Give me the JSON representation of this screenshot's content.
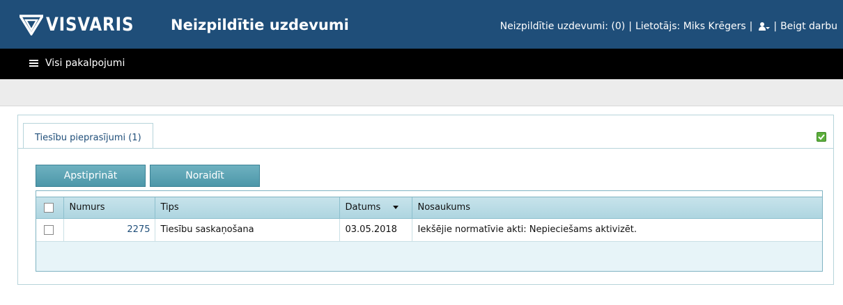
{
  "header": {
    "logo_text": "VISVARIS",
    "page_title": "Neizpildītie uzdevumi",
    "pending_tasks": "Neizpildītie uzdevumi: (0)",
    "separator": "|",
    "user": "Lietotājs: Miks Krēgers",
    "logout": "Beigt darbu"
  },
  "nav": {
    "all_services": "Visi pakalpojumi"
  },
  "panel": {
    "tab_label": "Tiesību pieprasījumi (1)",
    "buttons": {
      "approve": "Apstiprināt",
      "reject": "Noraidīt"
    },
    "table": {
      "columns": [
        "Numurs",
        "Tips",
        "Datums",
        "Nosaukums"
      ],
      "rows": [
        {
          "number": "2275",
          "type": "Tiesību saskaņošana",
          "date": "03.05.2018",
          "name": "Iekšējie normatīvie akti: Nepieciešams aktivizēt."
        }
      ]
    }
  },
  "colors": {
    "header_bg": "#1f4e79",
    "nav_bg": "#000000",
    "button_bg": "#4d97a9",
    "grid_header_bg": "#aed5e0",
    "check_icon": "#5cae3c"
  }
}
